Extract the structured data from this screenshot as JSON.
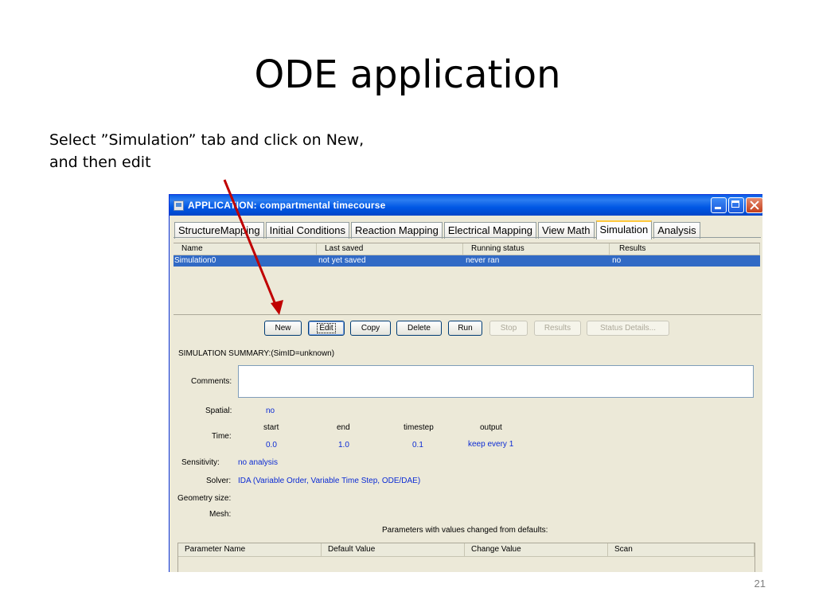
{
  "slide": {
    "title": "ODE application",
    "instruction_line1": "Select ”Simulation” tab and click on New,",
    "instruction_line2": "and then edit",
    "page_number": "21"
  },
  "window": {
    "title": "APPLICATION: compartmental timecourse",
    "icon": "app-window-icon",
    "controls": [
      "minimize-icon",
      "maximize-icon",
      "close-icon"
    ]
  },
  "tabs": [
    {
      "label": "StructureMapping",
      "active": false
    },
    {
      "label": "Initial Conditions",
      "active": false
    },
    {
      "label": "Reaction Mapping",
      "active": false
    },
    {
      "label": "Electrical Mapping",
      "active": false
    },
    {
      "label": "View Math",
      "active": false
    },
    {
      "label": "Simulation",
      "active": true
    },
    {
      "label": "Analysis",
      "active": false
    }
  ],
  "sim_table": {
    "headers": [
      "Name",
      "Last saved",
      "Running status",
      "Results"
    ],
    "rows": [
      [
        "Simulation0",
        "not yet saved",
        "never ran",
        "no"
      ]
    ]
  },
  "buttons": {
    "new": "New",
    "edit": "Edit",
    "copy": "Copy",
    "delete": "Delete",
    "run": "Run",
    "stop": "Stop",
    "results": "Results",
    "status_details": "Status Details..."
  },
  "summary": {
    "heading": "SIMULATION SUMMARY:(SimID=unknown)",
    "comments_label": "Comments:",
    "spatial_label": "Spatial:",
    "spatial_value": "no",
    "time_label": "Time:",
    "time_headers": [
      "start",
      "end",
      "timestep",
      "output"
    ],
    "time_values": [
      "0.0",
      "1.0",
      "0.1",
      "keep every 1"
    ],
    "sensitivity_label": "Sensitivity:",
    "sensitivity_value": "no analysis",
    "solver_label": "Solver:",
    "solver_value": "IDA (Variable Order, Variable Time Step, ODE/DAE)",
    "geometry_label": "Geometry size:",
    "mesh_label": "Mesh:",
    "params_caption": "Parameters with values changed from defaults:"
  },
  "params_table": {
    "headers": [
      "Parameter Name",
      "Default Value",
      "Change Value",
      "Scan"
    ]
  },
  "colors": {
    "titlebar": "#0a5ee6",
    "selection": "#316ac5",
    "value_text": "#0b2bd4",
    "arrow": "#c00000",
    "active_tab_highlight": "#ffc83c"
  }
}
